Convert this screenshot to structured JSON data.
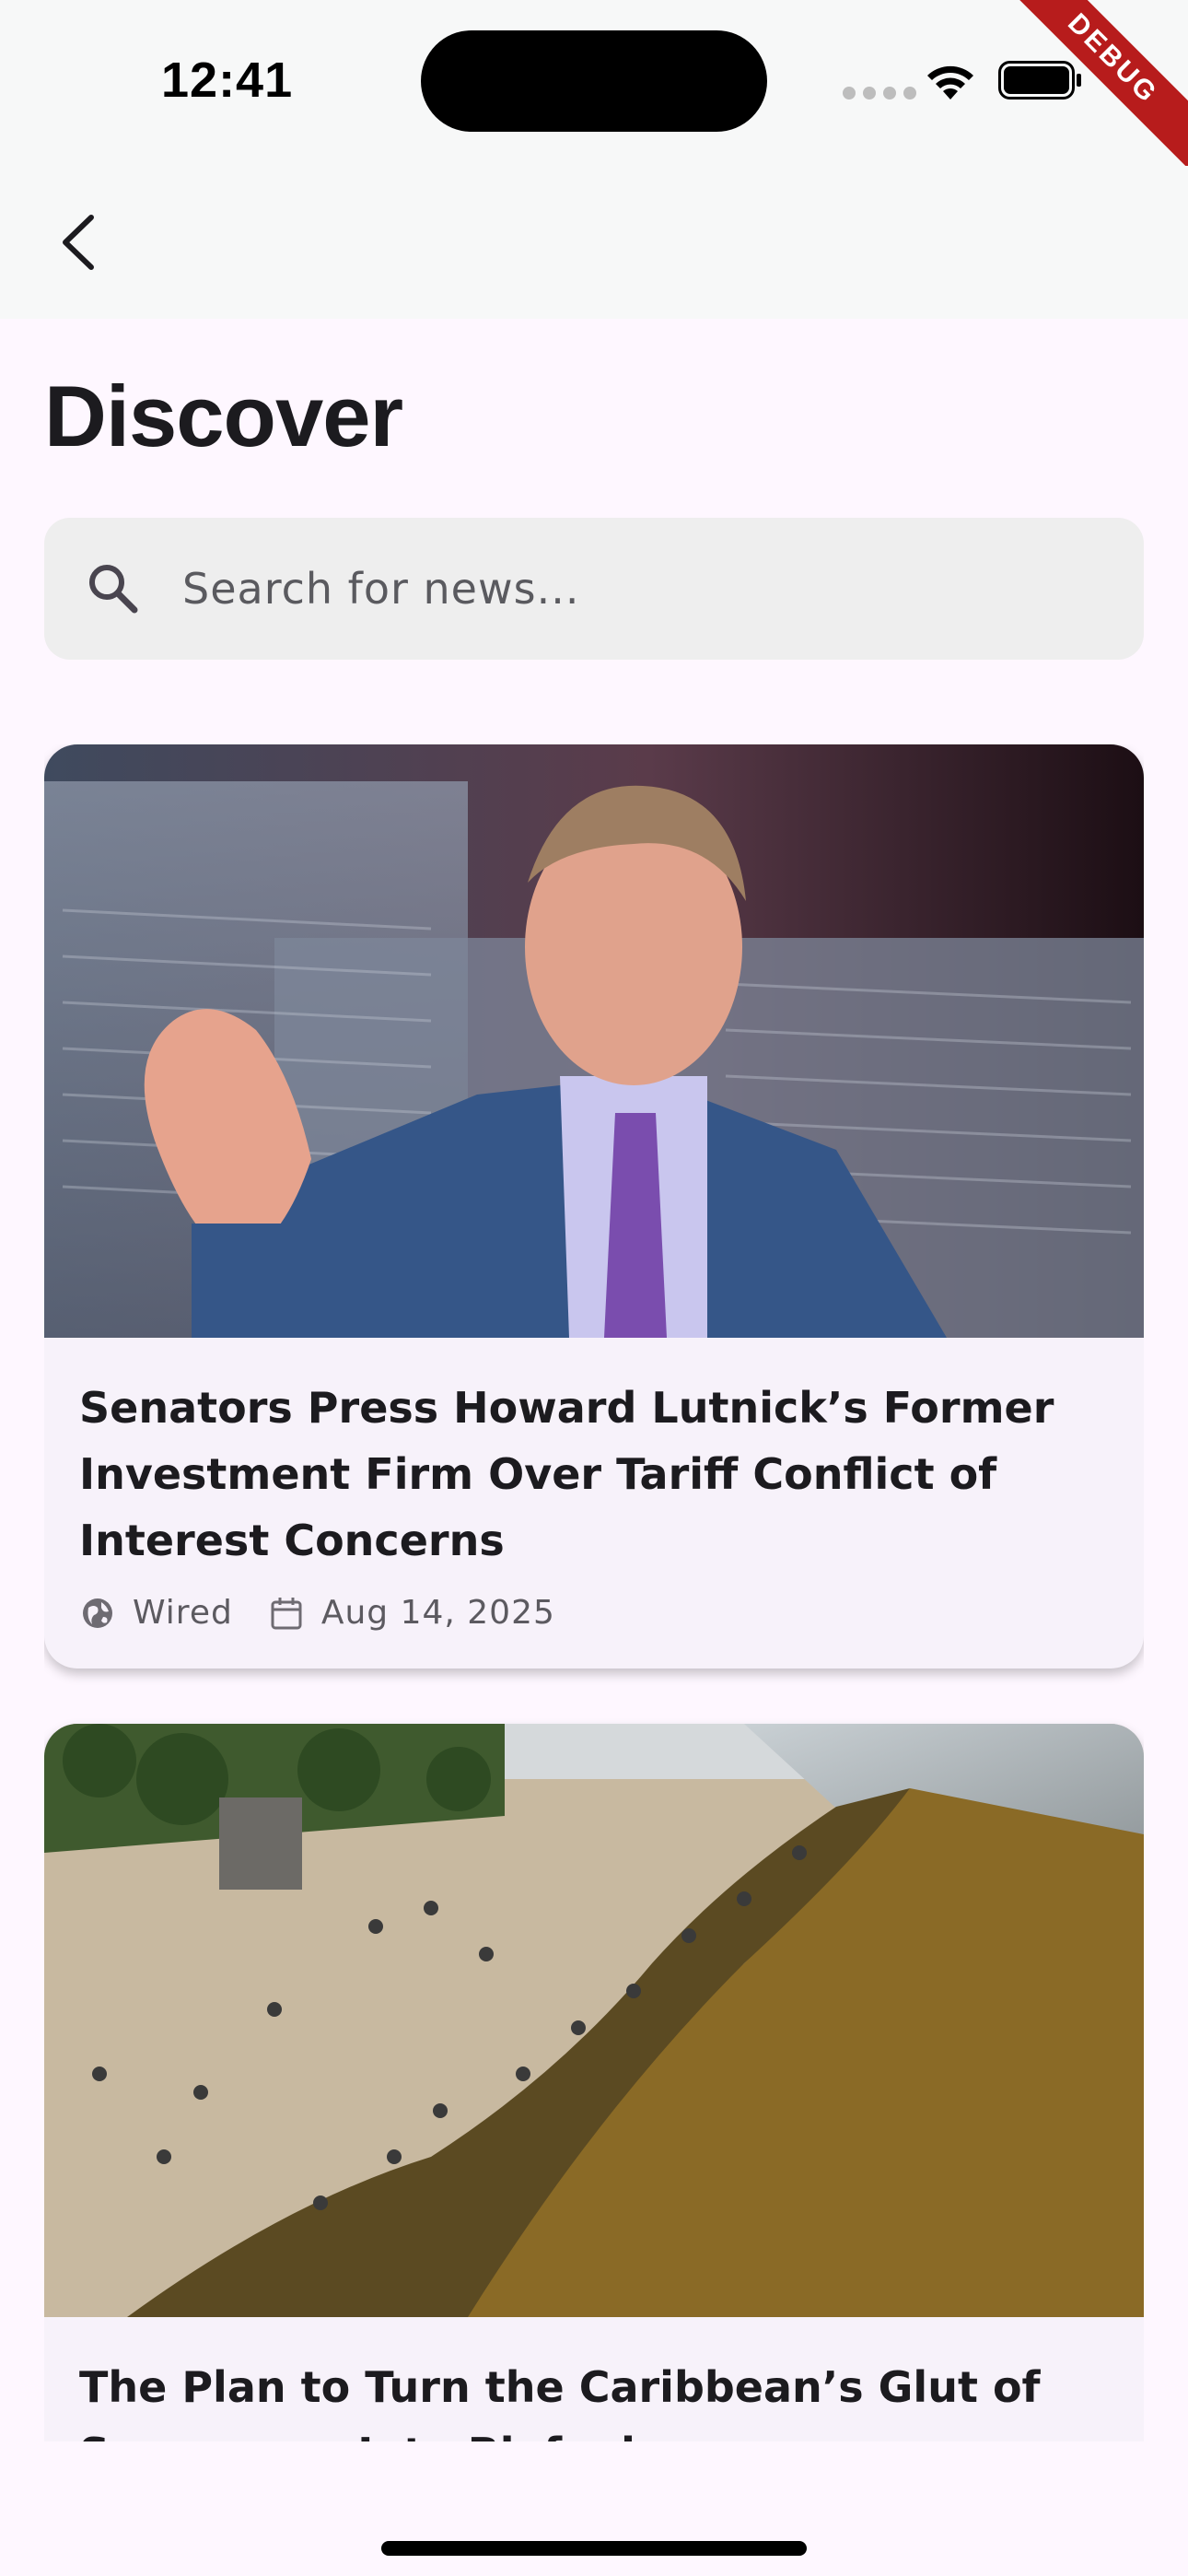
{
  "status_bar": {
    "time": "12:41",
    "debug_label": "DEBUG"
  },
  "page": {
    "title": "Discover"
  },
  "search": {
    "placeholder": "Search for news..."
  },
  "articles": [
    {
      "title": "Senators Press Howard Lutnick’s Former Investment Firm Over Tariff Conflict of Interest Concerns",
      "source": "Wired",
      "date": "Aug 14, 2025",
      "image": "senator-portrait-photo"
    },
    {
      "title": "The Plan to Turn the Caribbean’s Glut of Sargassum Into Biofuel",
      "image": "beach-seaweed-cleanup-photo"
    }
  ],
  "colors": {
    "background": "#FEF7FF",
    "app_bar": "#F7F8F8",
    "card": "#F7F2FA",
    "search_fill": "#EEEEEE",
    "debug_ribbon": "#B71C1C"
  }
}
